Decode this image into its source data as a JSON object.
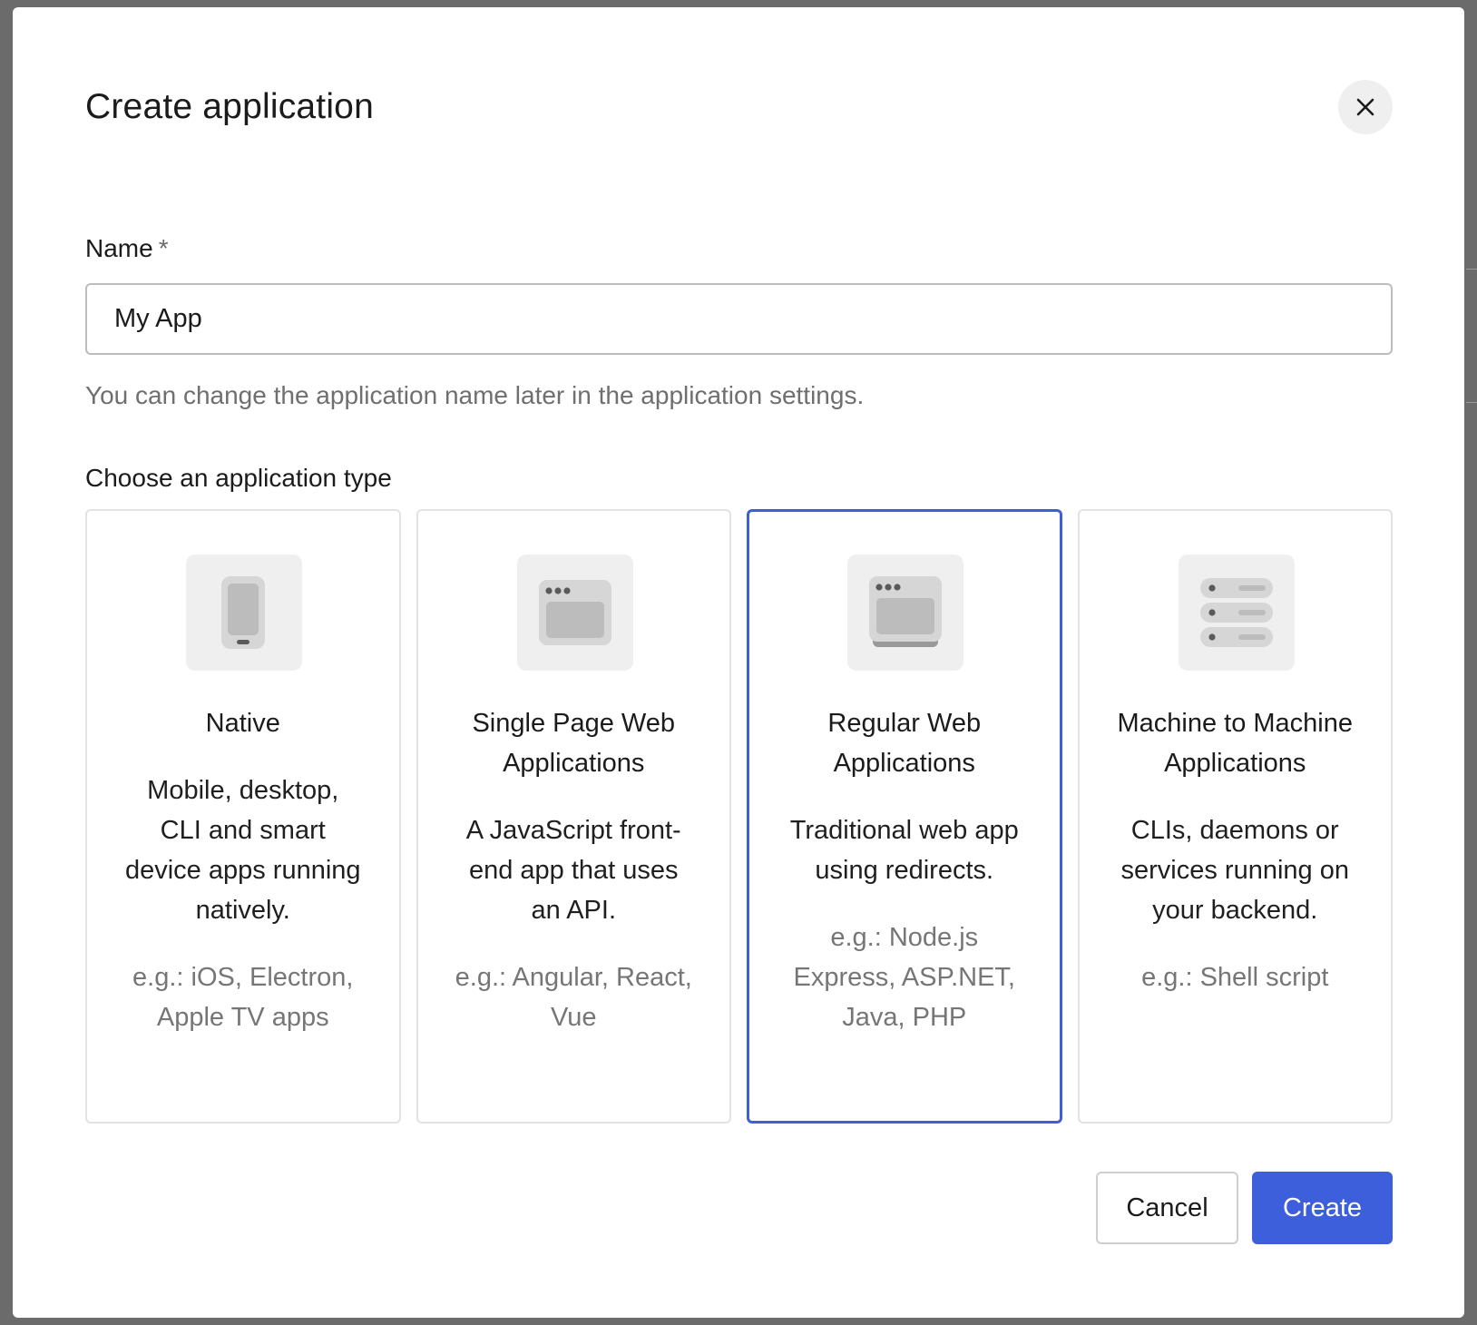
{
  "modal": {
    "title": "Create application",
    "close_icon": "close-icon"
  },
  "name_field": {
    "label": "Name",
    "required_marker": "*",
    "value": "My App",
    "helper": "You can change the application name later in the application settings."
  },
  "app_type": {
    "label": "Choose an application type",
    "selected": "Regular Web Applications",
    "cards": [
      {
        "icon": "mobile-device-icon",
        "title": "Native",
        "description": "Mobile, desktop, CLI and smart device apps running natively.",
        "example": "e.g.: iOS, Electron, Apple TV apps"
      },
      {
        "icon": "browser-window-icon",
        "title": "Single Page Web Applications",
        "description": "A JavaScript front-end app that uses an API.",
        "example": "e.g.: Angular, React, Vue"
      },
      {
        "icon": "stacked-browser-icon",
        "title": "Regular Web Applications",
        "description": "Traditional web app using redirects.",
        "example": "e.g.: Node.js Express, ASP.NET, Java, PHP"
      },
      {
        "icon": "server-stack-icon",
        "title": "Machine to Machine Applications",
        "description": "CLIs, daemons or services running on your backend.",
        "example": "e.g.: Shell script"
      }
    ]
  },
  "actions": {
    "cancel_label": "Cancel",
    "create_label": "Create"
  },
  "colors": {
    "accent": "#3e5fdc",
    "selected_border": "#3f5fd7",
    "icon_tile": "#efefef",
    "backdrop": "#6b6b6b"
  }
}
